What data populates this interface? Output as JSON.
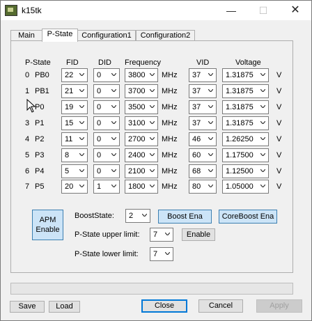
{
  "window": {
    "title": "k15tk",
    "minimize_glyph": "—",
    "maximize_glyph": "☐",
    "close_glyph": "✕"
  },
  "tabs": [
    {
      "label": "Main"
    },
    {
      "label": "P-State"
    },
    {
      "label": "Configuration1"
    },
    {
      "label": "Configuration2"
    }
  ],
  "table": {
    "headers": {
      "pstate": "P-State",
      "fid": "FID",
      "did": "DID",
      "frequency": "Frequency",
      "vid": "VID",
      "voltage": "Voltage"
    },
    "freq_unit": "MHz",
    "volt_unit": "V",
    "rows": [
      {
        "index": "0",
        "name": "PB0",
        "fid": "22",
        "did": "0",
        "freq": "3800",
        "vid": "37",
        "voltage": "1.31875"
      },
      {
        "index": "1",
        "name": "PB1",
        "fid": "21",
        "did": "0",
        "freq": "3700",
        "vid": "37",
        "voltage": "1.31875"
      },
      {
        "index": "",
        "name": "P0",
        "fid": "19",
        "did": "0",
        "freq": "3500",
        "vid": "37",
        "voltage": "1.31875"
      },
      {
        "index": "3",
        "name": "P1",
        "fid": "15",
        "did": "0",
        "freq": "3100",
        "vid": "37",
        "voltage": "1.31875"
      },
      {
        "index": "4",
        "name": "P2",
        "fid": "11",
        "did": "0",
        "freq": "2700",
        "vid": "46",
        "voltage": "1.26250"
      },
      {
        "index": "5",
        "name": "P3",
        "fid": "8",
        "did": "0",
        "freq": "2400",
        "vid": "60",
        "voltage": "1.17500"
      },
      {
        "index": "6",
        "name": "P4",
        "fid": "5",
        "did": "0",
        "freq": "2100",
        "vid": "68",
        "voltage": "1.12500"
      },
      {
        "index": "7",
        "name": "P5",
        "fid": "20",
        "did": "1",
        "freq": "1800",
        "vid": "80",
        "voltage": "1.05000"
      }
    ]
  },
  "controls": {
    "apm_button": "APM\nEnable",
    "boost_state_label": "BoostState:",
    "boost_state_value": "2",
    "boost_ena_button": "Boost Ena",
    "coreboost_ena_button": "CoreBoost Ena",
    "upper_limit_label": "P-State upper limit:",
    "upper_limit_value": "7",
    "enable_button": "Enable",
    "lower_limit_label": "P-State lower limit:",
    "lower_limit_value": "7"
  },
  "footer": {
    "save": "Save",
    "load": "Load",
    "close": "Close",
    "cancel": "Cancel",
    "apply": "Apply"
  }
}
